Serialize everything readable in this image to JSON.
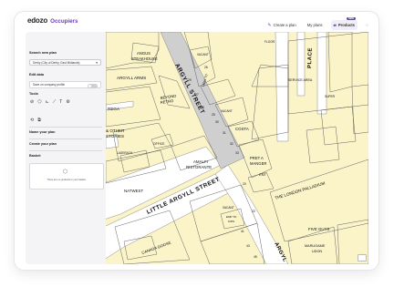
{
  "brand": {
    "name": "edozo",
    "product": "Occupiers",
    "accent": "#6b3fb0"
  },
  "topbar": {
    "create_plan": "Create a plan",
    "my_plans": "My plans",
    "products": "Products",
    "products_badge": "NEW"
  },
  "sidebar": {
    "search_title": "Search new plan",
    "search_value": "Derby (City of Derby, East Midlands)",
    "edit_title": "Edit data",
    "save_label": "Save on company profile",
    "tools_title": "Tools",
    "name_title": "Name your plan",
    "create_title": "Create your plan",
    "basket_title": "Basket",
    "basket_empty": "There are no products in your basket."
  },
  "map": {
    "streets": [
      "ARGYLL STREET",
      "LITTLE ARGYLL STREET",
      "ARGYL",
      "PLACE"
    ],
    "labels": [
      "ANGUS STEAKHOUSE",
      "ARGYLL ARMS",
      "BEYOND RETRO",
      "HOW TO",
      "VACANT",
      "OFFICE",
      "COSTA",
      "PRET A MANGER",
      "ENT",
      "AMALFI RISTORANTE",
      "REGA",
      "& OTHER STORIES",
      "LADERACH",
      "NATWEST",
      "THE LONDON PALLADIUM",
      "SERVICE AREA",
      "CANADA GOOSE",
      "FIVE GUYS",
      "MARUGAME UDON",
      "VACANT",
      "EMP TO KIDS",
      "VACANT",
      "FLOOR",
      "SUPER"
    ],
    "numbers": [
      "20",
      "22",
      "25",
      "26",
      "27",
      "28",
      "29",
      "30",
      "31",
      "32",
      "33",
      "41",
      "43",
      "45"
    ]
  }
}
